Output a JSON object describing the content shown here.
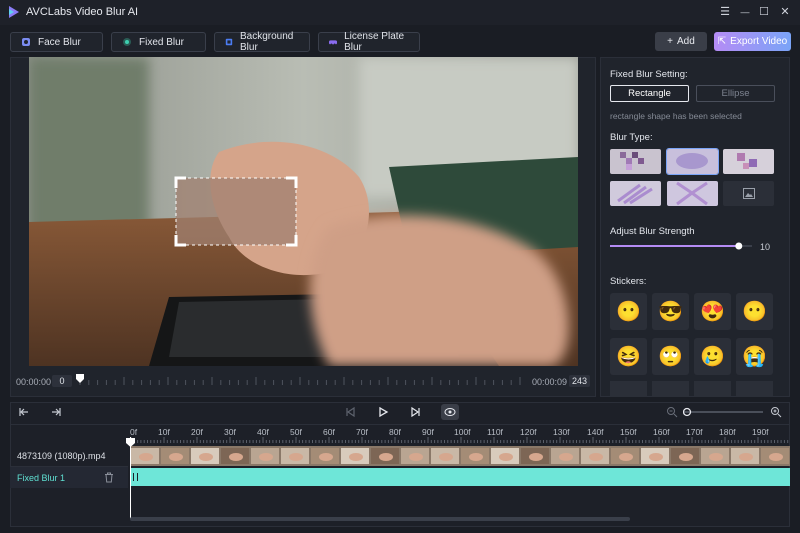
{
  "app": {
    "title": "AVCLabs Video Blur AI",
    "accent": "#a78bfa"
  },
  "window_controls": {
    "menu": "☰",
    "minimize": "—",
    "maximize": "☐",
    "close": "✕"
  },
  "mode_tabs": [
    {
      "label": "Face Blur",
      "icon": "face-icon",
      "color": "#7b8cf0"
    },
    {
      "label": "Fixed Blur",
      "icon": "fixed-blur-icon",
      "color": "#3ecfb0"
    },
    {
      "label": "Background Blur",
      "icon": "background-icon",
      "color": "#4b7cf2"
    },
    {
      "label": "License Plate Blur",
      "icon": "car-icon",
      "color": "#8a6cf0"
    }
  ],
  "actions": {
    "add": "Add",
    "add_icon": "+",
    "export": "Export Video",
    "export_icon": "⇱"
  },
  "preview": {
    "time_start": "00:00:00",
    "frame_start": "0",
    "time_end": "00:00:09",
    "frame_end": "243",
    "progress": 0.0
  },
  "settings": {
    "fixed_blur_title": "Fixed Blur Setting:",
    "shape_rectangle": "Rectangle",
    "shape_ellipse": "Ellipse",
    "shape_hint": "rectangle shape has been selected",
    "blur_type_title": "Blur Type:",
    "blur_strength_title": "Adjust Blur Strength",
    "blur_strength_value": "10",
    "blur_strength_fraction": 0.92,
    "stickers_title": "Stickers:",
    "stickers": [
      "😶",
      "😎",
      "😍",
      "😶",
      "😆",
      "🙄",
      "🥲",
      "😭"
    ]
  },
  "timeline": {
    "ruler": [
      "0f",
      "10f",
      "20f",
      "30f",
      "40f",
      "50f",
      "60f",
      "70f",
      "80f",
      "90f",
      "100f",
      "110f",
      "120f",
      "130f",
      "140f",
      "150f",
      "160f",
      "170f",
      "180f",
      "190f"
    ],
    "video_track": "4873109 (1080p).mp4",
    "blur_track": "Fixed Blur 1"
  }
}
